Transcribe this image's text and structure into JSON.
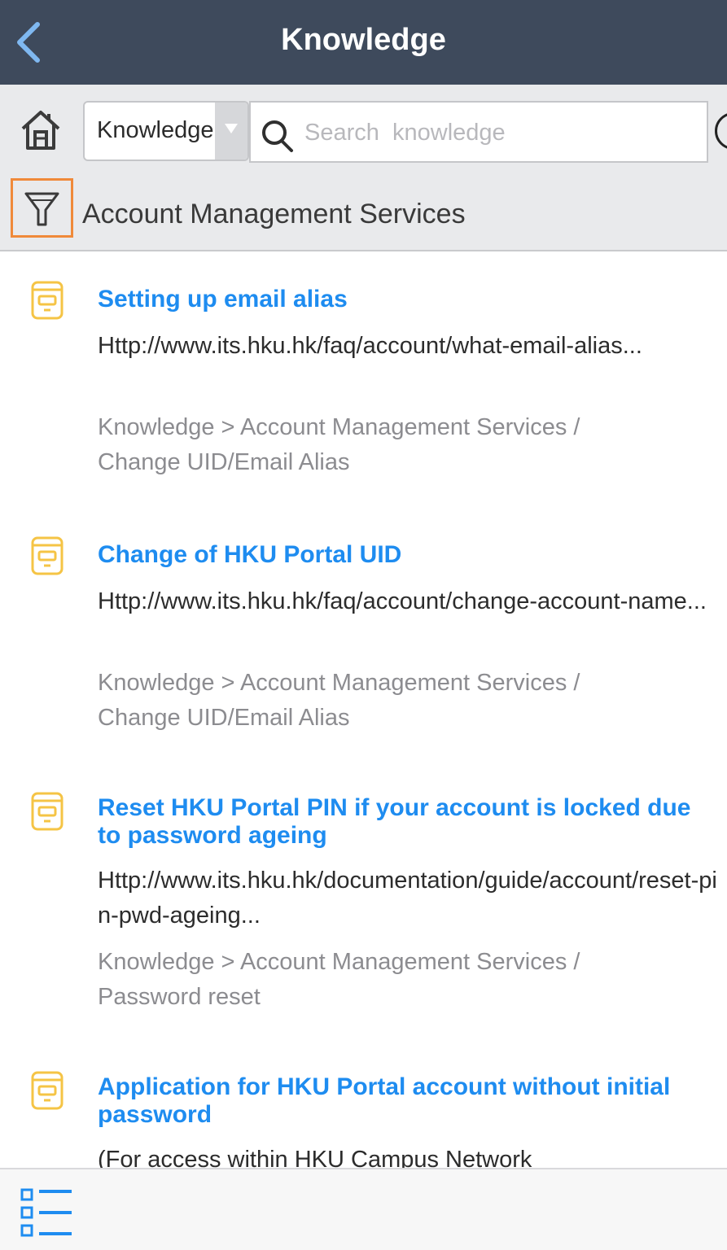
{
  "navbar": {
    "title": "Knowledge",
    "back_icon": "chevron-left-icon"
  },
  "toolbar": {
    "home_icon": "home-icon",
    "select_value": "Knowledge",
    "search_placeholder": "Search  knowledge",
    "filter_icon": "funnel-icon",
    "filter_label": "Account Management Services"
  },
  "results": [
    {
      "title": "Setting up email alias",
      "snippet": "Http://www.its.hku.hk/faq/account/what-email-alias...",
      "path": "Knowledge > Account Management Services / Change UID/Email Alias"
    },
    {
      "title": "Change of HKU Portal UID",
      "snippet": "Http://www.its.hku.hk/faq/account/change-account-name...",
      "path": "Knowledge > Account Management Services / Change UID/Email Alias"
    },
    {
      "title": "Reset HKU Portal PIN if your account is locked due to password ageing",
      "snippet": "Http://www.its.hku.hk/documentation/guide/account/reset-pin-pwd-ageing...",
      "path": "Knowledge > Account Management Services / Password reset"
    },
    {
      "title": "Application for HKU Portal account without initial password",
      "snippet": "(For access within HKU Campus Network",
      "path": ""
    }
  ],
  "bottom_bar": {
    "list_icon": "list-icon"
  },
  "colors": {
    "navbar_bg": "#3e4a5c",
    "title_link": "#1e8cf0",
    "doc_icon": "#f5c445",
    "filter_highlight": "#f08a3a"
  }
}
